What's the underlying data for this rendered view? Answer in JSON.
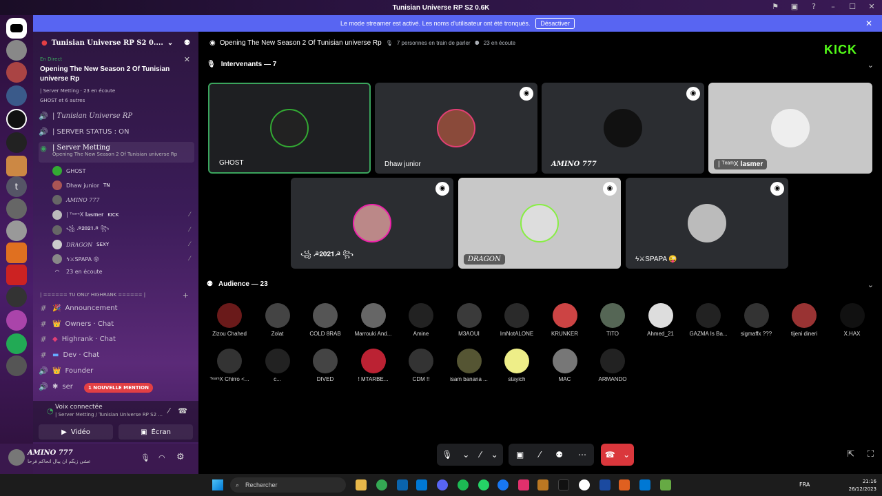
{
  "window": {
    "title": "Tunisian Universe RP S2 0.6K"
  },
  "banner": {
    "text": "Le mode streamer est activé. Les noms d'utilisateur ont été tronqués.",
    "button": "Désactiver"
  },
  "server": {
    "name": "Tunisian Universe RP S2 0...."
  },
  "live": {
    "tag": "En Direct",
    "title": "Opening The New Season 2 Of Tunisian universe Rp",
    "meta": "| Server Metting · 23 en écoute",
    "with": "GHOST et 6 autres"
  },
  "channels": [
    {
      "label": "| Tunisian Universe RP"
    },
    {
      "label": "| SERVER STATUS : ON"
    },
    {
      "label": "| Server Metting",
      "sub": "Opening The New Season 2 Of Tunisian universe Rp"
    }
  ],
  "members": [
    {
      "name": "GHOST"
    },
    {
      "name": "Dhaw junior",
      "tag": "TN"
    },
    {
      "name": "AMINO 777"
    },
    {
      "name": "| ᵀᵉᵃᵐX 𝐈𝐚𝐬𝐦𝐞𝐫",
      "tag": "KICK"
    },
    {
      "name": "꧁ ☭𝟐𝟎𝟐𝟏☭ ꧂"
    },
    {
      "name": "DRAGON",
      "tag": "SEXY"
    },
    {
      "name": "ϟ⚔SPAPA 😜"
    },
    {
      "name": "23 en écoute"
    }
  ],
  "category": "| ====== TU ONLY HIGHRANK ====== |",
  "text_channels": [
    {
      "label": "Announcement"
    },
    {
      "label": "Owners · Chat"
    },
    {
      "label": "Highrank · Chat"
    },
    {
      "label": "Dev · Chat"
    },
    {
      "label": "Founder"
    },
    {
      "label": "ser"
    }
  ],
  "mention": "1 NOUVELLE MENTION",
  "voice": {
    "status": "Voix connectée",
    "channel": "| Server Metting / Tunisian Universe RP S2 ...",
    "video": "Vidéo",
    "screen": "Écran"
  },
  "user": {
    "name": "AMINO 777",
    "status": "عشی زیگم ان ییال انحاکم فرحا"
  },
  "stage": {
    "title": "Opening The New Season 2 Of Tunisian universe Rp",
    "speaking": "7 personnes en train de parler",
    "listening": "23 en écoute",
    "speakers_header": "Intervenants — 7",
    "audience_header": "Audience — 23"
  },
  "speakers": [
    {
      "name": "GHOST"
    },
    {
      "name": "Dhaw junior"
    },
    {
      "name": "AMINO 777"
    },
    {
      "name": "| ᵀᵉᵃᵐX 𝐈𝐚𝐬𝐦𝐞𝐫"
    },
    {
      "name": "꧁ ☭𝟐𝟎𝟐𝟏☭ ꧂"
    },
    {
      "name": "DRAGON"
    },
    {
      "name": "ϟ⚔SPAPA 😜"
    }
  ],
  "audience": [
    "Zizou Chahed",
    "Zolat",
    "COLD 8RAB",
    "Marrouki And...",
    "Amine",
    "M3AOUI",
    "ImNotALONE",
    "KRUNKER",
    "TITO",
    "Ahmed_21",
    "GAZMA Is Ba...",
    "sigmaffx ???",
    "tijeni dineri",
    "X.HAX",
    "ᵀᵉᵃᵐX Chirro <...",
    "c...",
    "DIVED",
    "! MTARBE...",
    "CDM !!",
    "isam banana ...",
    "stayich",
    "MAC",
    "ARMANDO"
  ],
  "kick": "KICK",
  "taskbar": {
    "search": "Rechercher",
    "lang": "FRA",
    "time": "21:16",
    "date": "26/12/2023"
  },
  "colors": {
    "accent": "#5865f2",
    "live": "#3ba55d",
    "danger": "#da373c",
    "kick": "#53fc18"
  }
}
